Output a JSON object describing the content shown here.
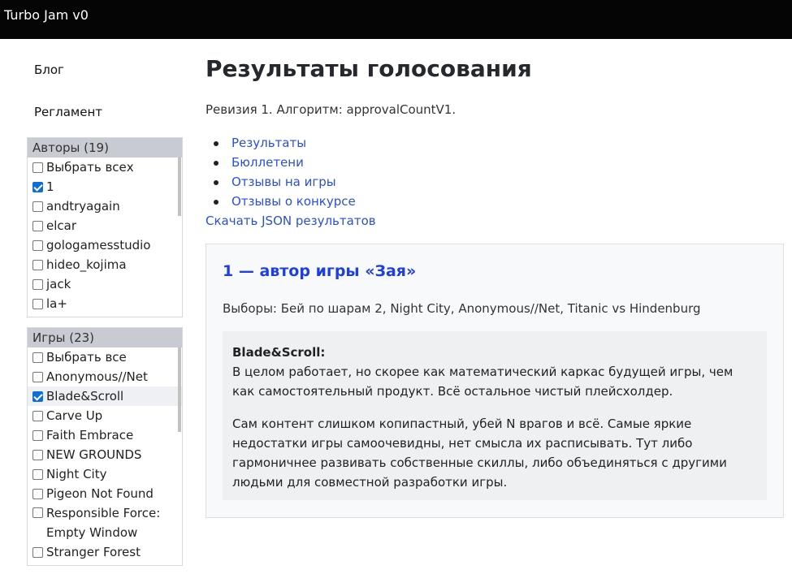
{
  "app": {
    "title": "Turbo Jam v0"
  },
  "sidebar": {
    "links": [
      {
        "label": "Блог"
      },
      {
        "label": "Регламент"
      }
    ],
    "authors": {
      "header": "Авторы (19)",
      "items": [
        {
          "label": "Выбрать всех",
          "checked": false
        },
        {
          "label": "1",
          "checked": true
        },
        {
          "label": "andtryagain",
          "checked": false
        },
        {
          "label": "elcar",
          "checked": false
        },
        {
          "label": "gologamesstudio",
          "checked": false
        },
        {
          "label": "hideo_kojima",
          "checked": false
        },
        {
          "label": "jack",
          "checked": false
        },
        {
          "label": "la+",
          "checked": false
        }
      ]
    },
    "games": {
      "header": "Игры (23)",
      "items": [
        {
          "label": "Выбрать все",
          "checked": false
        },
        {
          "label": "Anonymous//Net",
          "checked": false
        },
        {
          "label": "Blade&Scroll",
          "checked": true
        },
        {
          "label": "Carve Up",
          "checked": false
        },
        {
          "label": "Faith Embrace",
          "checked": false
        },
        {
          "label": "NEW GROUNDS",
          "checked": false
        },
        {
          "label": "Night City",
          "checked": false
        },
        {
          "label": "Pigeon Not Found",
          "checked": false
        },
        {
          "label": "Responsible Force: Empty Window",
          "checked": false
        },
        {
          "label": "Stranger Forest",
          "checked": false
        }
      ]
    }
  },
  "main": {
    "title": "Результаты голосования",
    "revision": "Ревизия 1. Алгоритм: approvalCountV1.",
    "nav": [
      {
        "label": "Результаты"
      },
      {
        "label": "Бюллетени"
      },
      {
        "label": "Отзывы на игры"
      },
      {
        "label": "Отзывы о конкурсе"
      }
    ],
    "download": "Скачать JSON результатов",
    "card": {
      "title": "1 — автор игры «Зая»",
      "choices": "Выборы: Бей по шарам 2, Night City, Anonymous//Net, Titanic vs Hindenburg",
      "review": {
        "game": "Blade&Scroll:",
        "paragraph1": "В целом работает, но скорее как математический каркас будущей игры, чем как самостоятельный продукт. Всё остальное чистый плейсхолдер.",
        "paragraph2": "Сам контент слишком копипастный, убей N врагов и всё. Самые яркие недостатки игры самоочевидны, нет смысла их расписывать. Тут либо гармоничнее развивать собственные скиллы, либо объединяться с другими людьми для совместной разработки игры."
      }
    }
  },
  "colors": {
    "navbar": "#050505",
    "link": "#2a4fd8",
    "card_title": "#1d3ee0",
    "checkbox": "#0b6fd6"
  }
}
